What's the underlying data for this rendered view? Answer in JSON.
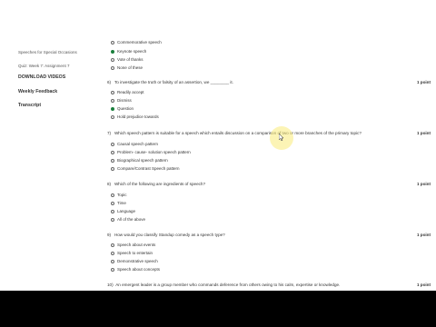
{
  "sidebar": {
    "items": [
      {
        "label": "Speeches for Special Occasions"
      },
      {
        "label": "Quiz: Week 7: Assignment 7"
      },
      {
        "label": "DOWNLOAD VIDEOS"
      },
      {
        "label": "Weekly Feedback"
      },
      {
        "label": "Transcript"
      }
    ]
  },
  "questions": [
    {
      "number": "",
      "text": "",
      "point": "",
      "options": [
        {
          "label": "Commemorative speech",
          "selected": false
        },
        {
          "label": "Keynote speech",
          "selected": true
        },
        {
          "label": "Vote of thanks",
          "selected": false
        },
        {
          "label": "None of these",
          "selected": false
        }
      ]
    },
    {
      "number": "6)",
      "text": "To investigate the truth or falsity of an assertion, we ________ it.",
      "point": "1 point",
      "options": [
        {
          "label": "Readily accept",
          "selected": false
        },
        {
          "label": "Dismiss",
          "selected": false
        },
        {
          "label": "Question",
          "selected": true
        },
        {
          "label": "Hold prejudice towards",
          "selected": false
        }
      ]
    },
    {
      "number": "7)",
      "text": "Which speech pattern is suitable for a speech which entails discussion on a comparison of two or more branches of the primary topic?",
      "point": "1 point",
      "options": [
        {
          "label": "Causal speech pattern",
          "selected": false
        },
        {
          "label": "Problem- cause- solution speech pattern",
          "selected": false
        },
        {
          "label": "Biographical speech pattern",
          "selected": false
        },
        {
          "label": "Compare/Contrast Speech pattern",
          "selected": false
        }
      ]
    },
    {
      "number": "8)",
      "text": "Which of the following are ingredients of speech?",
      "point": "1 point",
      "options": [
        {
          "label": "Topic",
          "selected": false
        },
        {
          "label": "Time",
          "selected": false
        },
        {
          "label": "Language",
          "selected": false
        },
        {
          "label": "All of the above",
          "selected": false
        }
      ]
    },
    {
      "number": "9)",
      "text": "How would you classify Standup comedy as a speech type?",
      "point": "1 point",
      "options": [
        {
          "label": "Speech about events",
          "selected": false
        },
        {
          "label": "Speech to entertain",
          "selected": false
        },
        {
          "label": "Demonstrative speech",
          "selected": false
        },
        {
          "label": "Speech about concepts",
          "selected": false
        }
      ]
    },
    {
      "number": "10)",
      "text": "An emergent leader is a group member who commands deference from others owing to his calm, expertise or knowledge.",
      "point": "1 point",
      "options": []
    }
  ]
}
